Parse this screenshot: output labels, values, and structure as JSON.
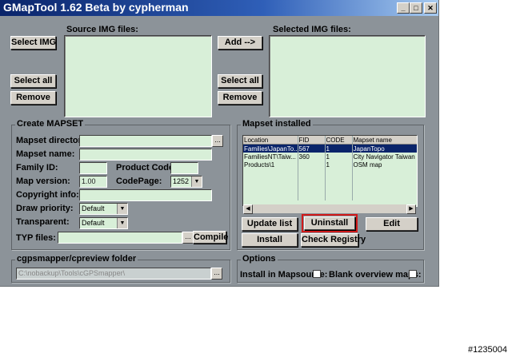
{
  "window": {
    "title": "GMapTool 1.62 Beta by cypherman"
  },
  "source": {
    "header": "Source IMG files:",
    "select_img": "Select IMG",
    "select_all": "Select all",
    "remove": "Remove"
  },
  "selected": {
    "header": "Selected IMG files:",
    "add": "Add -->",
    "select_all": "Select all",
    "remove": "Remove"
  },
  "create": {
    "title": "Create MAPSET",
    "mapset_directory": "Mapset directory:",
    "mapset_name": "Mapset name:",
    "family_id": "Family ID:",
    "product_code": "Product Code:",
    "map_version": "Map version:",
    "map_version_value": "1.00",
    "codepage": "CodePage:",
    "codepage_value": "1252",
    "copyright": "Copyright info:",
    "draw_priority": "Draw priority:",
    "draw_priority_value": "Default",
    "transparent": "Transparent:",
    "transparent_value": "Default",
    "typ_files": "TYP files:",
    "compile": "Compile",
    "dots": "..."
  },
  "installed": {
    "title": "Mapset installed",
    "columns": [
      "Location",
      "FID",
      "CODE",
      "Mapset name"
    ],
    "rows": [
      [
        "Families\\JapanTo...",
        "567",
        "1",
        "JapanTopo"
      ],
      [
        "FamiliesNT\\Taiw...",
        "360",
        "1",
        "City Navigator Taiwan N"
      ],
      [
        "Products\\1",
        "",
        "1",
        "OSM map"
      ]
    ],
    "update_list": "Update list",
    "uninstall": "Uninstall",
    "edit": "Edit",
    "install": "Install",
    "check_registry": "Check Registry"
  },
  "cgps": {
    "title": "cgpsmapper/cpreview folder",
    "path": "C:\\nobackup\\Tools\\cGPSmapper\\",
    "dots": "..."
  },
  "options": {
    "title": "Options",
    "install_in_mapsource": "Install in Mapsource:",
    "blank_overview": "Blank overview maps:"
  },
  "watermark": "#1235004",
  "colors": {
    "accent_red": "#d11a1a",
    "list_bg": "#d8efd8",
    "panel": "#8c9399"
  }
}
